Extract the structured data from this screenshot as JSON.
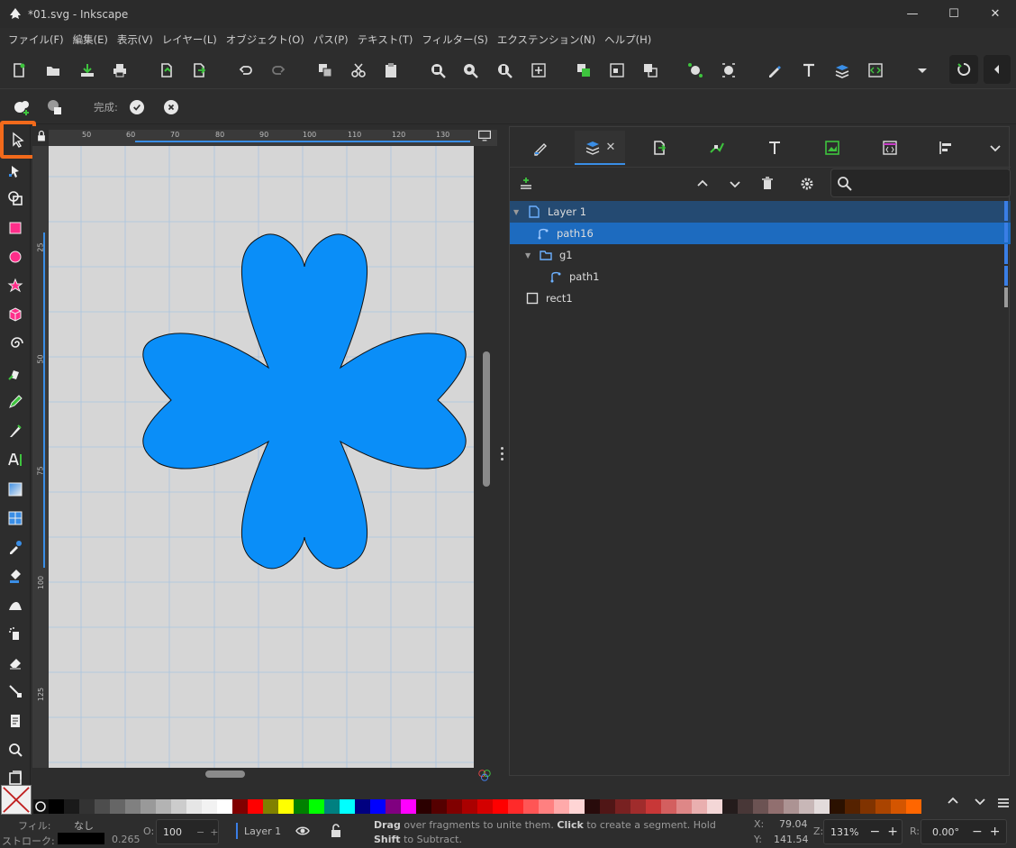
{
  "window": {
    "title": "*01.svg - Inkscape",
    "controls": [
      "minimize",
      "maximize",
      "close"
    ]
  },
  "menu": [
    "ファイル(F)",
    "編集(E)",
    "表示(V)",
    "レイヤー(L)",
    "オブジェクト(O)",
    "パス(P)",
    "テキスト(T)",
    "フィルター(S)",
    "エクステンション(N)",
    "ヘルプ(H)"
  ],
  "commands": [
    "new-document-icon",
    "open-icon",
    "import-icon",
    "print-icon",
    "export-icon",
    "export-selection-icon",
    "undo-icon",
    "redo-icon",
    "duplicate-icon",
    "cut-icon",
    "paste-icon",
    "zoom-selection-icon",
    "zoom-drawing-icon",
    "zoom-page-icon",
    "zoom-center-icon",
    "group-icon",
    "ungroup-icon",
    "raise-icon",
    "node-edit-icon",
    "snap-nodes-icon",
    "fill-stroke-icon",
    "text-icon",
    "layers-icon",
    "xml-editor-icon",
    "more-dropdown-icon",
    "snap-toggle-icon",
    "collapse-icon"
  ],
  "tool_controls": {
    "label": "完成:",
    "confirm_icon": "check-circle-icon",
    "cancel_icon": "close-circle-icon"
  },
  "tools": [
    "selector-tool-icon",
    "node-tool-icon",
    "shape-builder-tool-icon",
    "rectangle-tool-icon",
    "ellipse-tool-icon",
    "star-tool-icon",
    "3d-box-tool-icon",
    "spiral-tool-icon",
    "pen-tool-icon",
    "pencil-tool-icon",
    "calligraphy-tool-icon",
    "text-tool-icon",
    "gradient-tool-icon",
    "mesh-tool-icon",
    "dropper-tool-icon",
    "paint-bucket-tool-icon",
    "tweak-tool-icon",
    "spray-tool-icon",
    "eraser-tool-icon",
    "connector-tool-icon",
    "pages-tool-icon",
    "zoom-tool-icon",
    "measure-tool-icon"
  ],
  "ruler": {
    "h_ticks": [
      "50",
      "60",
      "70",
      "80",
      "90",
      "100",
      "110",
      "120",
      "130"
    ],
    "v_ticks": [
      "25",
      "50",
      "75",
      "100",
      "125"
    ]
  },
  "dock": {
    "tabs": [
      "fill-stroke-tab-icon",
      "layers-objects-tab-icon",
      "export-tab-icon",
      "node-tab-icon",
      "text-tab-icon",
      "symbols-tab-icon",
      "xml-tab-icon",
      "align-tab-icon",
      "more-tabs-icon"
    ],
    "toolbar": [
      "add-layer-icon",
      "move-up-icon",
      "move-down-icon",
      "delete-icon",
      "settings-gear-icon",
      "search-icon"
    ],
    "search_placeholder": "",
    "tree": [
      {
        "name": "Layer 1",
        "kind": "layer",
        "depth": 0,
        "expanded": true,
        "color": "#3a7ee6"
      },
      {
        "name": "path16",
        "kind": "path",
        "depth": 1,
        "selected": true,
        "color": "#3a7ee6"
      },
      {
        "name": "g1",
        "kind": "group",
        "depth": 1,
        "expanded": true,
        "color": "#3a7ee6"
      },
      {
        "name": "path1",
        "kind": "path",
        "depth": 2,
        "color": "#3a7ee6"
      },
      {
        "name": "rect1",
        "kind": "rect",
        "depth": 0,
        "color": "#9a9a9a"
      }
    ]
  },
  "colors": {
    "shape_fill": "#0a8ef8",
    "accent": "#f26a1b",
    "selection": "#1d6bbf"
  },
  "palette": [
    "#000000",
    "#1a1a1a",
    "#333333",
    "#4d4d4d",
    "#666666",
    "#808080",
    "#999999",
    "#b3b3b3",
    "#cccccc",
    "#e6e6e6",
    "#f2f2f2",
    "#ffffff",
    "#800000",
    "#ff0000",
    "#808000",
    "#ffff00",
    "#008000",
    "#00ff00",
    "#008080",
    "#00ffff",
    "#000080",
    "#0000ff",
    "#800080",
    "#ff00ff",
    "#2b0000",
    "#550000",
    "#800000",
    "#aa0000",
    "#d40000",
    "#ff0000",
    "#ff2a2a",
    "#ff5555",
    "#ff8080",
    "#ffaaaa",
    "#ffd5d5",
    "#280b0b",
    "#501616",
    "#782121",
    "#a02c2c",
    "#c83737",
    "#d35f5f",
    "#de8787",
    "#e9afaf",
    "#f4d7d7",
    "#241c1c",
    "#483737",
    "#6c5353",
    "#916f6f",
    "#ac9393",
    "#c8b7b7",
    "#e3dbdb",
    "#2b1100",
    "#552200",
    "#803300",
    "#aa4400",
    "#d45500",
    "#ff6600"
  ],
  "status": {
    "fill_label": "フィル:",
    "fill_value": "なし",
    "stroke_label": "ストローク:",
    "stroke_width": "0.265",
    "opacity_label": "O:",
    "opacity_value": "100",
    "layer_name": "Layer 1",
    "message_parts": [
      "Drag",
      " over fragments to unite them. ",
      "Click",
      " to create a segment. Hold ",
      "Shift",
      " to Subtract."
    ],
    "x_label": "X:",
    "x_value": "79.04",
    "y_label": "Y:",
    "y_value": "141.54",
    "zoom_label": "Z:",
    "zoom_value": "131%",
    "rotation_label": "R:",
    "rotation_value": "0.00°"
  }
}
